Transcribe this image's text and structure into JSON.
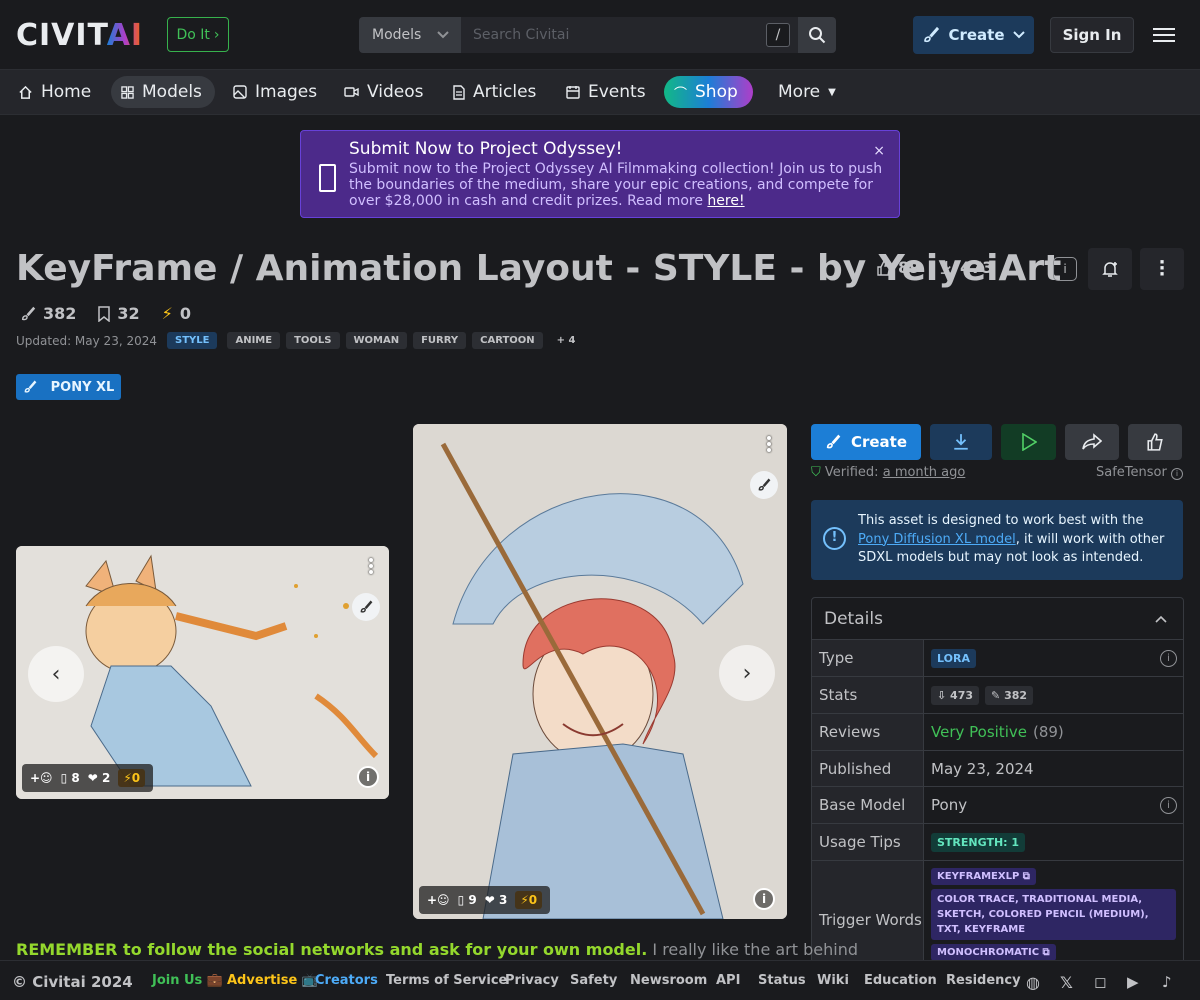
{
  "header": {
    "logo_text": "CIVIT",
    "logo_accent": "AI",
    "doit_label": "Do It",
    "search_scope": "Models",
    "search_placeholder": "Search Civitai",
    "search_shortcut": "/",
    "create_label": "Create",
    "signin_label": "Sign In"
  },
  "nav": {
    "items": [
      {
        "label": "Home",
        "icon": "home-icon"
      },
      {
        "label": "Models",
        "icon": "grid-icon"
      },
      {
        "label": "Images",
        "icon": "photo-icon"
      },
      {
        "label": "Videos",
        "icon": "video-icon"
      },
      {
        "label": "Articles",
        "icon": "file-icon"
      },
      {
        "label": "Events",
        "icon": "calendar-icon"
      },
      {
        "label": "Shop",
        "icon": "rainbow-icon"
      },
      {
        "label": "More",
        "icon": "caret-down-icon"
      }
    ],
    "active": "Models"
  },
  "banner": {
    "title": "Submit Now to Project Odyssey!",
    "body": "Submit now to the Project Odyssey AI Filmmaking collection! Join us to push the boundaries of the medium, share your epic creations, and compete for over $28,000 in cash and credit prizes. Read more",
    "link": "here!",
    "close": "×"
  },
  "model": {
    "title": "KeyFrame / Animation Layout - STYLE - by YeiyeiArt",
    "likes": "89",
    "downloads": "473",
    "generations": "382",
    "bookmarks": "32",
    "buzz": "0",
    "updated": "Updated: May 23, 2024",
    "tags": [
      "STYLE",
      "ANIME",
      "TOOLS",
      "WOMAN",
      "FURRY",
      "CARTOON",
      "+ 4"
    ],
    "base_badge": "PONY XL"
  },
  "gallery": {
    "cards": [
      {
        "reactions": "8",
        "hearts": "2",
        "buzz": "0"
      },
      {
        "reactions": "9",
        "hearts": "3",
        "buzz": "0"
      }
    ]
  },
  "actions": {
    "create_label": "Create",
    "verified_prefix": "Verified:",
    "verified_time": "a month ago",
    "file_format": "SafeTensor"
  },
  "notice": {
    "pre": "This asset is designed to work best with the",
    "link": "Pony Diffusion XL model",
    "post": ", it will work with other SDXL models but may not look as intended."
  },
  "details": {
    "heading": "Details",
    "rows": {
      "type_label": "Type",
      "type_value": "LORA",
      "stats_label": "Stats",
      "stats_downloads": "473",
      "stats_generations": "382",
      "reviews_label": "Reviews",
      "reviews_value": "Very Positive",
      "reviews_count": "(89)",
      "published_label": "Published",
      "published_value": "May 23, 2024",
      "base_label": "Base Model",
      "base_value": "Pony",
      "tips_label": "Usage Tips",
      "tips_value": "STRENGTH: 1",
      "trigger_label": "Trigger Words",
      "triggers": [
        "KEYFRAMEXLP",
        "COLOR TRACE, TRADITIONAL MEDIA, SKETCH, COLORED PENCIL (MEDIUM), TXT, KEYFRAME",
        "MONOCHROMATIC"
      ]
    }
  },
  "description": {
    "highlight": "REMEMBER to follow the social networks and ask for your own model.",
    "rest": "I really like the art behind"
  },
  "footer": {
    "copyright": "© Civitai 2024",
    "links": [
      "Join Us 💼",
      "Advertise 📺",
      "Creators",
      "Terms of Service",
      "Privacy",
      "Safety",
      "Newsroom",
      "API",
      "Status",
      "Wiki",
      "Education",
      "Residency"
    ],
    "colors": {
      "join": "#40c057",
      "advertise": "#fcc419",
      "creators": "#4dabf7"
    }
  }
}
